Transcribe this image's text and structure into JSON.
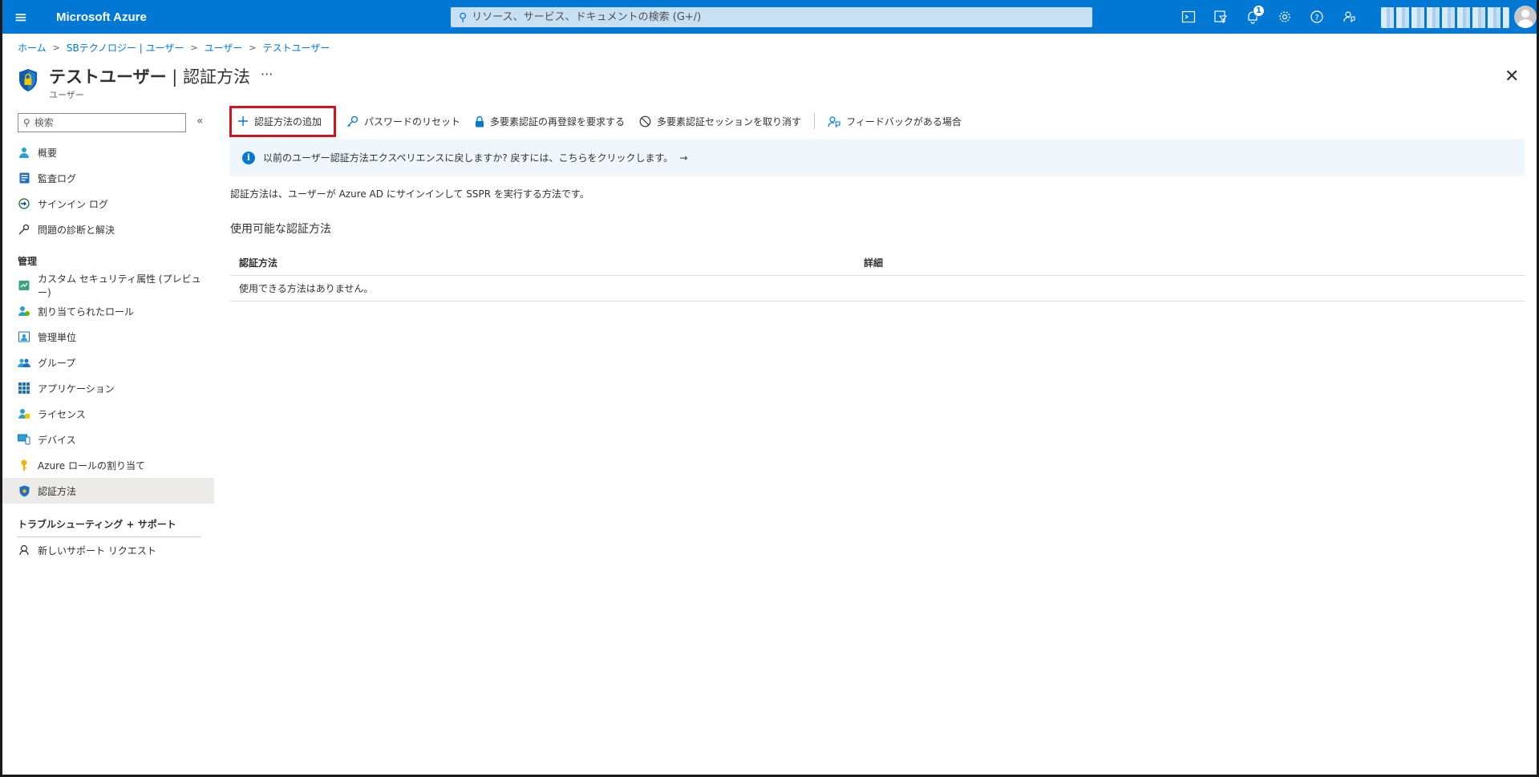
{
  "topbar": {
    "brand": "Microsoft Azure",
    "search_placeholder": "リソース、サービス、ドキュメントの検索 (G+/)",
    "notification_count": "1",
    "icons": [
      "cloud-shell-icon",
      "directory-filter-icon",
      "notification-icon",
      "settings-icon",
      "help-icon",
      "feedback-icon"
    ]
  },
  "breadcrumb": [
    "ホーム",
    "SBテクノロジー | ユーザー",
    "ユーザー",
    "テストユーザー"
  ],
  "page": {
    "title_main": "テストユーザー",
    "title_sep": " | ",
    "title_section": "認証方法",
    "subtitle": "ユーザー",
    "more": "···"
  },
  "sidebar": {
    "search_placeholder": "検索",
    "collapse": "«",
    "items": [
      {
        "label": "概要",
        "icon": "user-icon"
      },
      {
        "label": "監査ログ",
        "icon": "audit-log-icon"
      },
      {
        "label": "サインイン ログ",
        "icon": "signin-log-icon"
      },
      {
        "label": "問題の診断と解決",
        "icon": "wrench-icon"
      }
    ],
    "section_manage": "管理",
    "manage_items": [
      {
        "label": "カスタム セキュリティ属性 (プレビュー)",
        "icon": "custom-attribute-icon"
      },
      {
        "label": "割り当てられたロール",
        "icon": "assigned-roles-icon"
      },
      {
        "label": "管理単位",
        "icon": "admin-unit-icon"
      },
      {
        "label": "グループ",
        "icon": "groups-icon"
      },
      {
        "label": "アプリケーション",
        "icon": "applications-icon"
      },
      {
        "label": "ライセンス",
        "icon": "licenses-icon"
      },
      {
        "label": "デバイス",
        "icon": "devices-icon"
      },
      {
        "label": "Azure ロールの割り当て",
        "icon": "key-icon"
      },
      {
        "label": "認証方法",
        "icon": "shield-icon"
      }
    ],
    "section_support": "トラブルシューティング + サポート",
    "support_items": [
      {
        "label": "新しいサポート リクエスト",
        "icon": "support-request-icon"
      }
    ]
  },
  "toolbar": {
    "add": "認証方法の追加",
    "reset_password": "パスワードのリセット",
    "require_reregister": "多要素認証の再登録を要求する",
    "revoke_sessions": "多要素認証セッションを取り消す",
    "feedback": "フィードバックがある場合"
  },
  "info": {
    "text": "以前のユーザー認証方法エクスペリエンスに戻しますか? 戻すには、こちらをクリックします。",
    "arrow": "→"
  },
  "main": {
    "description": "認証方法は、ユーザーが Azure AD にサインインして SSPR を実行する方法です。",
    "usable_heading": "使用可能な認証方法",
    "table": {
      "columns": [
        "認証方法",
        "詳細"
      ],
      "empty_message": "使用できる方法はありません。"
    }
  },
  "colors": {
    "accent": "#0078d4",
    "highlight_border": "#d0161d",
    "info_bg": "#eff6fc"
  }
}
